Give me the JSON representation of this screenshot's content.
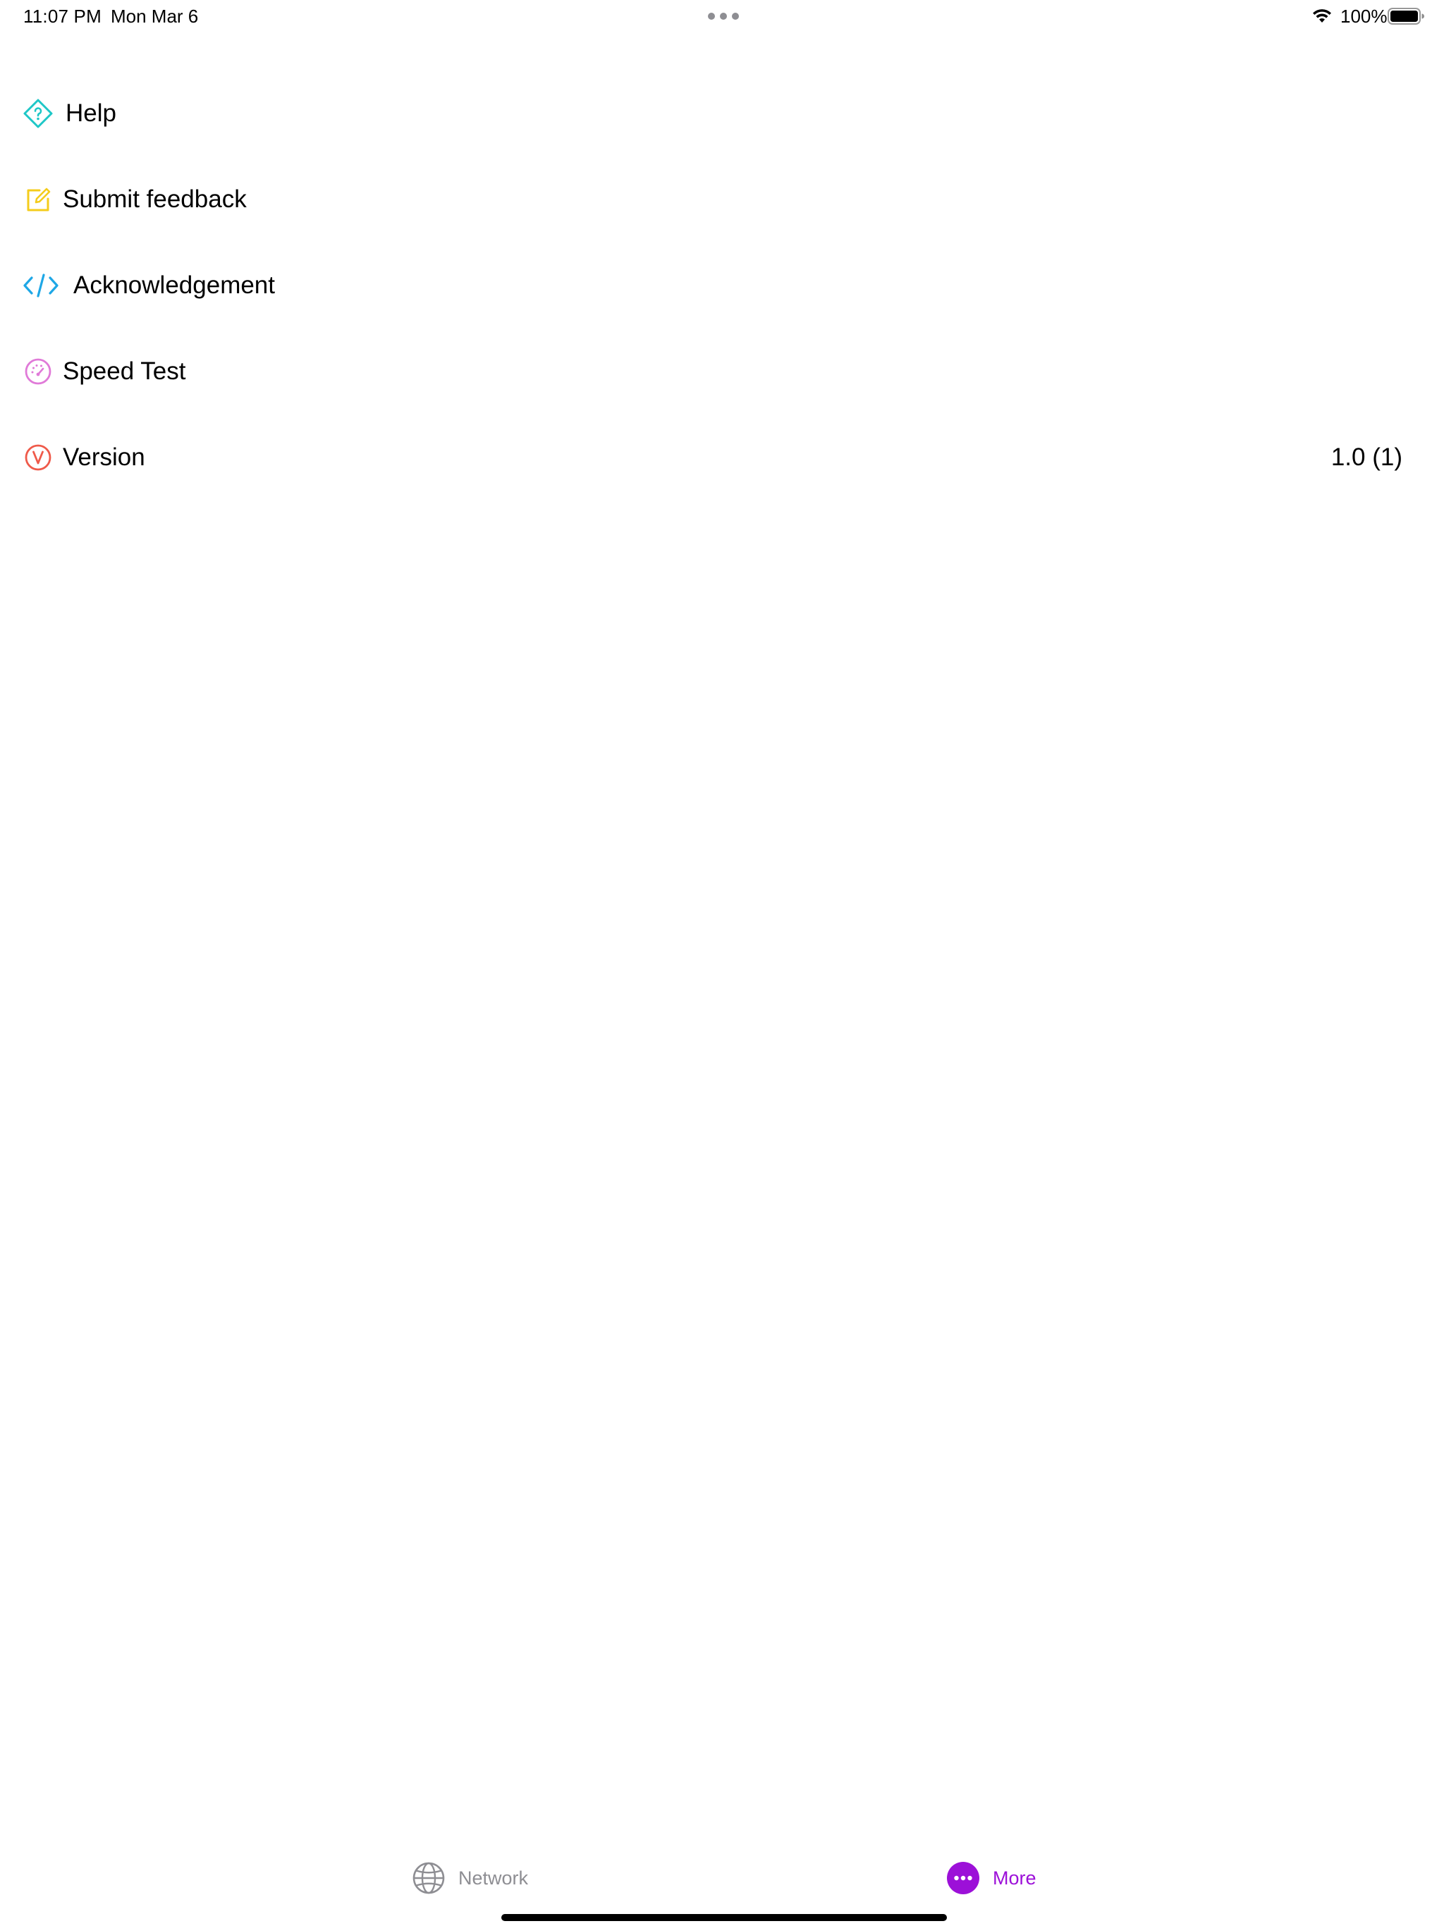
{
  "status_bar": {
    "time": "11:07 PM",
    "date": "Mon Mar 6",
    "battery_percent": "100%",
    "battery_level": 1.0,
    "wifi_icon": "wifi-icon",
    "battery_icon": "battery-icon"
  },
  "menu": {
    "items": [
      {
        "label": "Help",
        "icon": "help-diamond-icon",
        "color": "#1ec7c7"
      },
      {
        "label": "Submit feedback",
        "icon": "edit-note-icon",
        "color": "#f4cc1c"
      },
      {
        "label": "Acknowledgement",
        "icon": "code-icon",
        "color": "#1ea7e6"
      },
      {
        "label": "Speed Test",
        "icon": "speedometer-icon",
        "color": "#e07ad8"
      },
      {
        "label": "Version",
        "icon": "version-v-icon",
        "color": "#ef5a4a",
        "value": "1.0 (1)"
      }
    ]
  },
  "tab_bar": {
    "tabs": [
      {
        "label": "Network",
        "icon": "globe-icon",
        "selected": false,
        "color": "#8e8e93"
      },
      {
        "label": "More",
        "icon": "more-dots-icon",
        "selected": true,
        "color": "#9c10d8"
      }
    ]
  }
}
